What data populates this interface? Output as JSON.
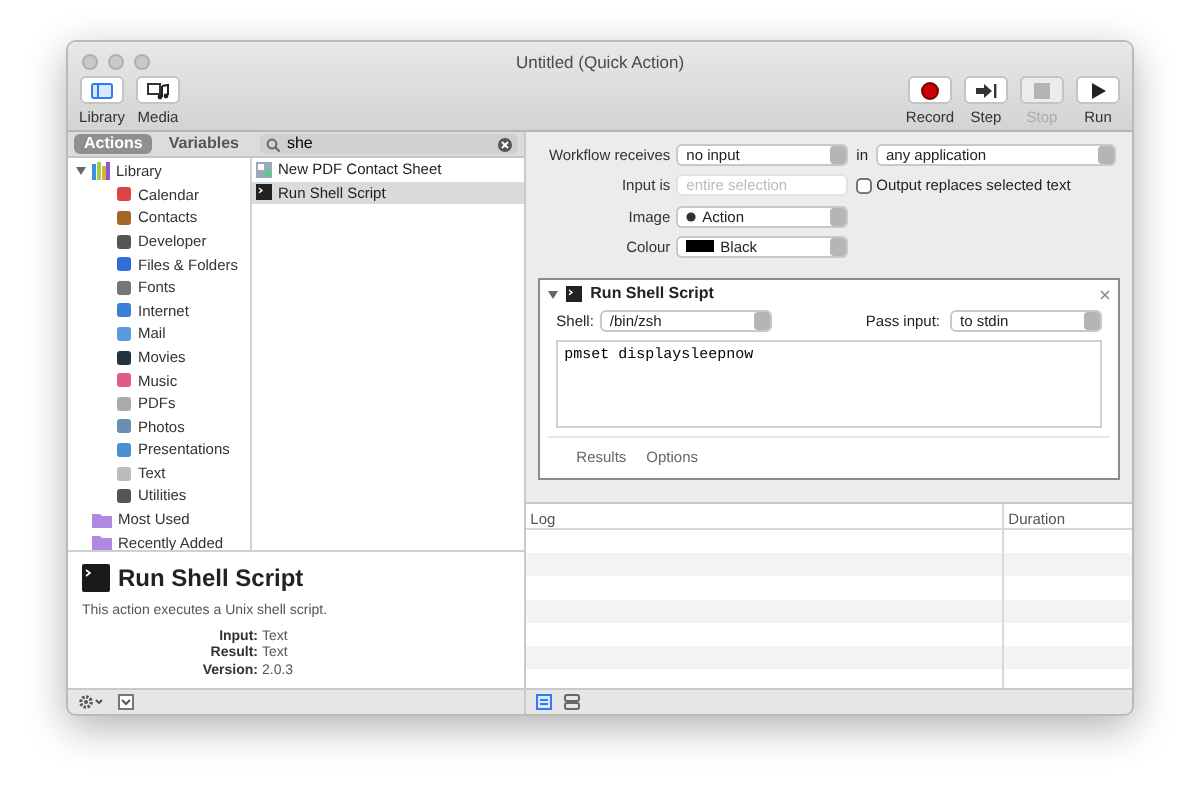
{
  "window": {
    "title": "Untitled (Quick Action)"
  },
  "toolbar": {
    "left": [
      {
        "label": "Library",
        "kind": "library",
        "disabled": false
      },
      {
        "label": "Media",
        "kind": "media",
        "disabled": false
      }
    ],
    "right": [
      {
        "label": "Record",
        "kind": "record",
        "disabled": false
      },
      {
        "label": "Step",
        "kind": "step",
        "disabled": false
      },
      {
        "label": "Stop",
        "kind": "stop",
        "disabled": true
      },
      {
        "label": "Run",
        "kind": "run",
        "disabled": false
      }
    ]
  },
  "sidebar": {
    "tabs": [
      {
        "label": "Actions",
        "selected": true
      },
      {
        "label": "Variables",
        "selected": false
      }
    ],
    "search": {
      "value": "she"
    },
    "tree": [
      {
        "label": "Library",
        "kind": "library",
        "expanded": true,
        "children": [
          {
            "label": "Calendar"
          },
          {
            "label": "Contacts"
          },
          {
            "label": "Developer"
          },
          {
            "label": "Files & Folders"
          },
          {
            "label": "Fonts"
          },
          {
            "label": "Internet"
          },
          {
            "label": "Mail"
          },
          {
            "label": "Movies"
          },
          {
            "label": "Music"
          },
          {
            "label": "PDFs"
          },
          {
            "label": "Photos"
          },
          {
            "label": "Presentations"
          },
          {
            "label": "Text"
          },
          {
            "label": "Utilities"
          }
        ]
      },
      {
        "label": "Most Used",
        "kind": "folder"
      },
      {
        "label": "Recently Added",
        "kind": "folder"
      }
    ],
    "results": [
      {
        "label": "New PDF Contact Sheet",
        "selected": false
      },
      {
        "label": "Run Shell Script",
        "selected": true
      }
    ],
    "description": {
      "title": "Run Shell Script",
      "text": "This action executes a Unix shell script.",
      "fields": [
        {
          "label": "Input:",
          "value": "Text"
        },
        {
          "label": "Result:",
          "value": "Text"
        },
        {
          "label": "Version:",
          "value": "2.0.3"
        }
      ]
    }
  },
  "workflow": {
    "receives": {
      "label": "Workflow receives",
      "value": "no input"
    },
    "in": {
      "label": "in",
      "value": "any application"
    },
    "input_is": {
      "label": "Input is",
      "placeholder": "entire selection",
      "disabled": true
    },
    "output_replaces": {
      "label": "Output replaces selected text",
      "checked": false
    },
    "image": {
      "label": "Image",
      "value": "Action"
    },
    "colour": {
      "label": "Colour",
      "value": "Black"
    }
  },
  "action": {
    "title": "Run Shell Script",
    "expanded": true,
    "shell": {
      "label": "Shell:",
      "value": "/bin/zsh"
    },
    "pass_input": {
      "label": "Pass input:",
      "value": "to stdin"
    },
    "script": "pmset displaysleepnow",
    "tabs": [
      "Results",
      "Options"
    ]
  },
  "log": {
    "columns": [
      "Log",
      "Duration"
    ]
  }
}
